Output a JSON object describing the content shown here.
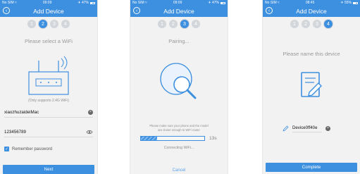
{
  "colors": {
    "accent": "#3d8fe0",
    "background": "#f2f2f2",
    "inactive_step": "#d3d6da",
    "muted_text": "#9a9a9a"
  },
  "screens": [
    {
      "status": {
        "carrier": "No SIM ≈",
        "time": "09:09",
        "battery": "✈ 47%",
        "battery_level": 0.47
      },
      "title": "Add Device",
      "steps": [
        "1",
        "2",
        "3",
        "4"
      ],
      "active_step": 2,
      "prompt": "Please select a WiFi",
      "note": "(Only supports 2.4G WiFi)",
      "wifi_name": "xiaozhuzaideiMac",
      "password": "123456789",
      "remember_label": "Remember password",
      "button": "Next"
    },
    {
      "status": {
        "carrier": "No SIM ≈",
        "time": "09:09",
        "battery": "✈ 47%",
        "battery_level": 0.47
      },
      "title": "Add Device",
      "steps": [
        "1",
        "2",
        "3",
        "4"
      ],
      "active_step": 3,
      "prompt": "Pairing...",
      "note_line1": "Please make sure your phone and the model",
      "note_line2": "are closer enough to WiFi router",
      "progress": 0.25,
      "countdown": "13s",
      "connecting": "Connecting WiFi...",
      "cancel": "Cancel"
    },
    {
      "status": {
        "carrier": "No SIM ≈",
        "time": "08:45",
        "battery": "✈ 55%",
        "battery_level": 0.55
      },
      "title": "Add Device",
      "steps": [
        "1",
        "2",
        "3",
        "4"
      ],
      "active_step": 4,
      "prompt": "Please name this device",
      "device_name": "Device0ff40e",
      "button": "Complete"
    }
  ]
}
